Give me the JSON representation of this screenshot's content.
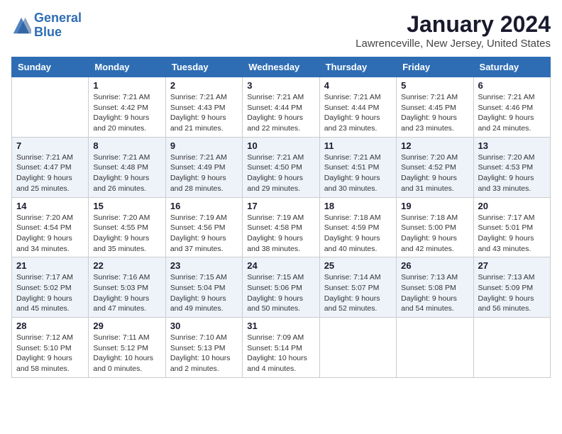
{
  "header": {
    "logo_text_general": "General",
    "logo_text_blue": "Blue",
    "month_title": "January 2024",
    "location": "Lawrenceville, New Jersey, United States"
  },
  "days_of_week": [
    "Sunday",
    "Monday",
    "Tuesday",
    "Wednesday",
    "Thursday",
    "Friday",
    "Saturday"
  ],
  "weeks": [
    [
      {
        "day": "",
        "info": ""
      },
      {
        "day": "1",
        "info": "Sunrise: 7:21 AM\nSunset: 4:42 PM\nDaylight: 9 hours\nand 20 minutes."
      },
      {
        "day": "2",
        "info": "Sunrise: 7:21 AM\nSunset: 4:43 PM\nDaylight: 9 hours\nand 21 minutes."
      },
      {
        "day": "3",
        "info": "Sunrise: 7:21 AM\nSunset: 4:44 PM\nDaylight: 9 hours\nand 22 minutes."
      },
      {
        "day": "4",
        "info": "Sunrise: 7:21 AM\nSunset: 4:44 PM\nDaylight: 9 hours\nand 23 minutes."
      },
      {
        "day": "5",
        "info": "Sunrise: 7:21 AM\nSunset: 4:45 PM\nDaylight: 9 hours\nand 23 minutes."
      },
      {
        "day": "6",
        "info": "Sunrise: 7:21 AM\nSunset: 4:46 PM\nDaylight: 9 hours\nand 24 minutes."
      }
    ],
    [
      {
        "day": "7",
        "info": "Sunrise: 7:21 AM\nSunset: 4:47 PM\nDaylight: 9 hours\nand 25 minutes."
      },
      {
        "day": "8",
        "info": "Sunrise: 7:21 AM\nSunset: 4:48 PM\nDaylight: 9 hours\nand 26 minutes."
      },
      {
        "day": "9",
        "info": "Sunrise: 7:21 AM\nSunset: 4:49 PM\nDaylight: 9 hours\nand 28 minutes."
      },
      {
        "day": "10",
        "info": "Sunrise: 7:21 AM\nSunset: 4:50 PM\nDaylight: 9 hours\nand 29 minutes."
      },
      {
        "day": "11",
        "info": "Sunrise: 7:21 AM\nSunset: 4:51 PM\nDaylight: 9 hours\nand 30 minutes."
      },
      {
        "day": "12",
        "info": "Sunrise: 7:20 AM\nSunset: 4:52 PM\nDaylight: 9 hours\nand 31 minutes."
      },
      {
        "day": "13",
        "info": "Sunrise: 7:20 AM\nSunset: 4:53 PM\nDaylight: 9 hours\nand 33 minutes."
      }
    ],
    [
      {
        "day": "14",
        "info": "Sunrise: 7:20 AM\nSunset: 4:54 PM\nDaylight: 9 hours\nand 34 minutes."
      },
      {
        "day": "15",
        "info": "Sunrise: 7:20 AM\nSunset: 4:55 PM\nDaylight: 9 hours\nand 35 minutes."
      },
      {
        "day": "16",
        "info": "Sunrise: 7:19 AM\nSunset: 4:56 PM\nDaylight: 9 hours\nand 37 minutes."
      },
      {
        "day": "17",
        "info": "Sunrise: 7:19 AM\nSunset: 4:58 PM\nDaylight: 9 hours\nand 38 minutes."
      },
      {
        "day": "18",
        "info": "Sunrise: 7:18 AM\nSunset: 4:59 PM\nDaylight: 9 hours\nand 40 minutes."
      },
      {
        "day": "19",
        "info": "Sunrise: 7:18 AM\nSunset: 5:00 PM\nDaylight: 9 hours\nand 42 minutes."
      },
      {
        "day": "20",
        "info": "Sunrise: 7:17 AM\nSunset: 5:01 PM\nDaylight: 9 hours\nand 43 minutes."
      }
    ],
    [
      {
        "day": "21",
        "info": "Sunrise: 7:17 AM\nSunset: 5:02 PM\nDaylight: 9 hours\nand 45 minutes."
      },
      {
        "day": "22",
        "info": "Sunrise: 7:16 AM\nSunset: 5:03 PM\nDaylight: 9 hours\nand 47 minutes."
      },
      {
        "day": "23",
        "info": "Sunrise: 7:15 AM\nSunset: 5:04 PM\nDaylight: 9 hours\nand 49 minutes."
      },
      {
        "day": "24",
        "info": "Sunrise: 7:15 AM\nSunset: 5:06 PM\nDaylight: 9 hours\nand 50 minutes."
      },
      {
        "day": "25",
        "info": "Sunrise: 7:14 AM\nSunset: 5:07 PM\nDaylight: 9 hours\nand 52 minutes."
      },
      {
        "day": "26",
        "info": "Sunrise: 7:13 AM\nSunset: 5:08 PM\nDaylight: 9 hours\nand 54 minutes."
      },
      {
        "day": "27",
        "info": "Sunrise: 7:13 AM\nSunset: 5:09 PM\nDaylight: 9 hours\nand 56 minutes."
      }
    ],
    [
      {
        "day": "28",
        "info": "Sunrise: 7:12 AM\nSunset: 5:10 PM\nDaylight: 9 hours\nand 58 minutes."
      },
      {
        "day": "29",
        "info": "Sunrise: 7:11 AM\nSunset: 5:12 PM\nDaylight: 10 hours\nand 0 minutes."
      },
      {
        "day": "30",
        "info": "Sunrise: 7:10 AM\nSunset: 5:13 PM\nDaylight: 10 hours\nand 2 minutes."
      },
      {
        "day": "31",
        "info": "Sunrise: 7:09 AM\nSunset: 5:14 PM\nDaylight: 10 hours\nand 4 minutes."
      },
      {
        "day": "",
        "info": ""
      },
      {
        "day": "",
        "info": ""
      },
      {
        "day": "",
        "info": ""
      }
    ]
  ]
}
